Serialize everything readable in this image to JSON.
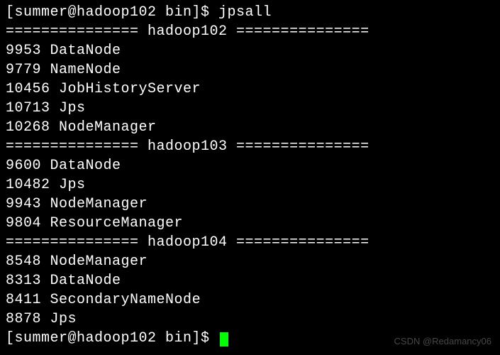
{
  "prompt1": {
    "text": "[summer@hadoop102 bin]$ ",
    "command": "jpsall"
  },
  "hosts": [
    {
      "header": "=============== hadoop102 ===============",
      "processes": [
        {
          "pid": "9953",
          "name": "DataNode"
        },
        {
          "pid": "9779",
          "name": "NameNode"
        },
        {
          "pid": "10456",
          "name": "JobHistoryServer"
        },
        {
          "pid": "10713",
          "name": "Jps"
        },
        {
          "pid": "10268",
          "name": "NodeManager"
        }
      ]
    },
    {
      "header": "=============== hadoop103 ===============",
      "processes": [
        {
          "pid": "9600",
          "name": "DataNode"
        },
        {
          "pid": "10482",
          "name": "Jps"
        },
        {
          "pid": "9943",
          "name": "NodeManager"
        },
        {
          "pid": "9804",
          "name": "ResourceManager"
        }
      ]
    },
    {
      "header": "=============== hadoop104 ===============",
      "processes": [
        {
          "pid": "8548",
          "name": "NodeManager"
        },
        {
          "pid": "8313",
          "name": "DataNode"
        },
        {
          "pid": "8411",
          "name": "SecondaryNameNode"
        },
        {
          "pid": "8878",
          "name": "Jps"
        }
      ]
    }
  ],
  "prompt2": {
    "text": "[summer@hadoop102 bin]$ "
  },
  "watermark": "CSDN @Redamancy06"
}
